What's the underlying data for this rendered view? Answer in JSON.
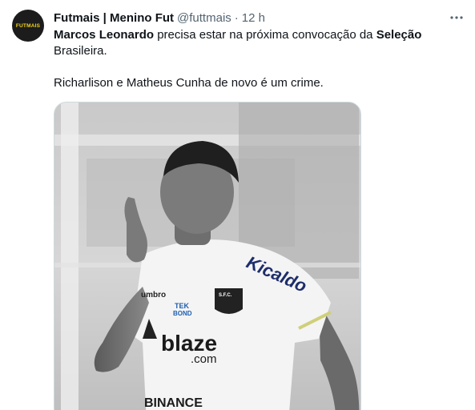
{
  "author": {
    "avatar_text": "FUTMAIS",
    "display_name": "Futmais | Menino Fut",
    "handle": "@futtmais",
    "separator": "·",
    "time": "12 h"
  },
  "tweet": {
    "line1_bold_a": "Marcos Leonardo",
    "line1_regular": " precisa estar na próxima convocação da ",
    "line1_bold_b": "Seleção",
    "line2": "Brasileira.",
    "line3": "Richarlison e Matheus Cunha de novo é um crime."
  },
  "media": {
    "sponsor_sleeve": "Kicaldo",
    "brand_umbro": "umbro",
    "brand_tek_1": "TEK",
    "brand_tek_2": "BOND",
    "crest_text": "S.F.C.",
    "sponsor_main": "blaze",
    "sponsor_main_sub": ".com",
    "sponsor_bottom": "BINANCE"
  },
  "colors": {
    "text_primary": "#0f1419",
    "text_secondary": "#536471",
    "avatar_bg": "#1c1c1c",
    "avatar_text": "#f2d21a"
  },
  "icons": {
    "more": "more-horizontal-icon"
  }
}
